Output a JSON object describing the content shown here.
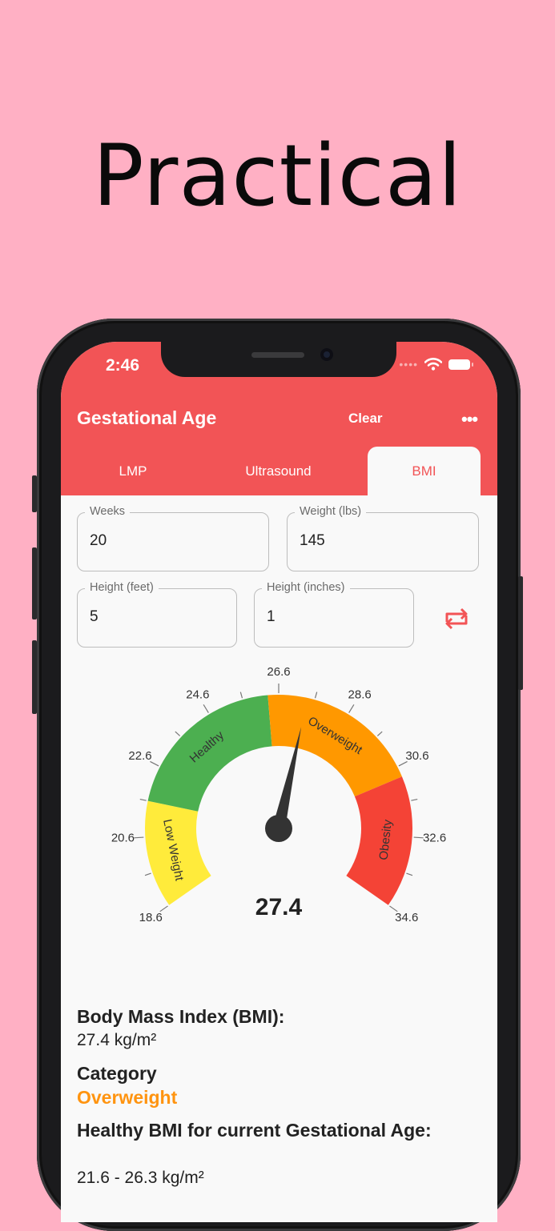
{
  "headline": "Practical",
  "status_bar": {
    "time": "2:46"
  },
  "app_bar": {
    "title": "Gestational Age",
    "clear_label": "Clear",
    "theme_icon": "moon-icon",
    "more_icon": "more-icon"
  },
  "tabs": [
    {
      "label": "LMP",
      "active": false
    },
    {
      "label": "Ultrasound",
      "active": false
    },
    {
      "label": "BMI",
      "active": true
    }
  ],
  "fields": {
    "weeks": {
      "label": "Weeks",
      "value": "20"
    },
    "weight": {
      "label": "Weight (lbs)",
      "value": "145"
    },
    "height_feet": {
      "label": "Height (feet)",
      "value": "5"
    },
    "height_inches": {
      "label": "Height (inches)",
      "value": "1"
    }
  },
  "swap_icon": "swap-units-icon",
  "chart_data": {
    "type": "gauge",
    "min": 18.6,
    "max": 34.6,
    "value": 27.4,
    "value_label": "27.4",
    "tick_labels": [
      "18.6",
      "20.6",
      "22.6",
      "24.6",
      "26.6",
      "28.6",
      "30.6",
      "32.6",
      "34.6"
    ],
    "ranges": [
      {
        "label": "Low Weight",
        "from": 18.6,
        "to": 21.6,
        "color": "#FFEB3B"
      },
      {
        "label": "Healthy",
        "from": 21.6,
        "to": 26.3,
        "color": "#4CAF50"
      },
      {
        "label": "Overweight",
        "from": 26.3,
        "to": 30.9,
        "color": "#FF9800"
      },
      {
        "label": "Obesity",
        "from": 30.9,
        "to": 34.6,
        "color": "#F44336"
      }
    ]
  },
  "results": {
    "bmi_heading": "Body Mass Index (BMI):",
    "bmi_value": "27.4 kg/m²",
    "category_heading": "Category",
    "category_value": "Overweight",
    "healthy_heading": "Healthy BMI for current Gestational Age:",
    "healthy_value": "21.6 - 26.3 kg/m²"
  },
  "colors": {
    "accent": "#F25456",
    "background": "#FFB0C4",
    "category": "#FF9410"
  }
}
